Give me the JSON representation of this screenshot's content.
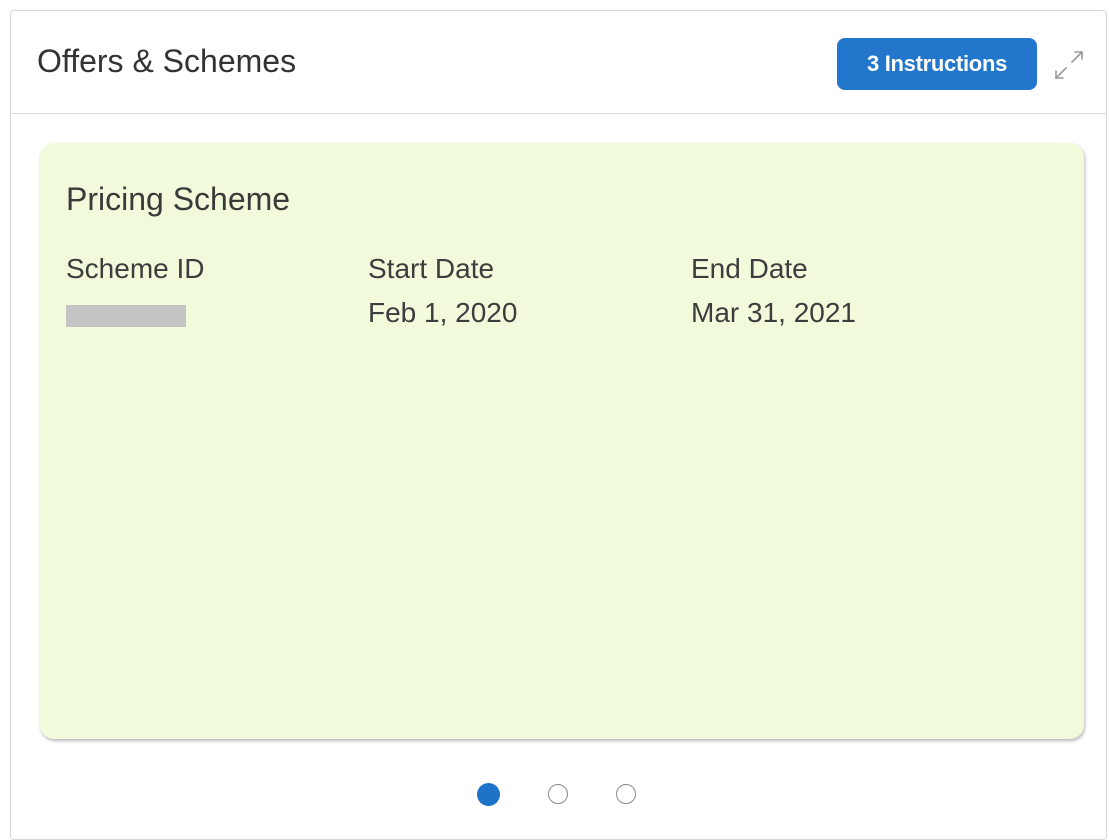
{
  "widget": {
    "title": "Offers & Schemes",
    "instructions_badge": "3 Instructions",
    "expand_icon": "expand-arrows-icon"
  },
  "card": {
    "title": "Pricing Scheme",
    "background": "#f1fbdc",
    "fields": [
      {
        "label": "Scheme ID",
        "value": "",
        "masked": true
      },
      {
        "label": "Start Date",
        "value": "Feb 1, 2020"
      },
      {
        "label": "End Date",
        "value": "Mar 31, 2021"
      }
    ]
  },
  "carousel": {
    "total_pages": 3,
    "active_page": 1
  },
  "colors": {
    "accent": "#2277cc",
    "active_dot": "#1d73c8"
  }
}
